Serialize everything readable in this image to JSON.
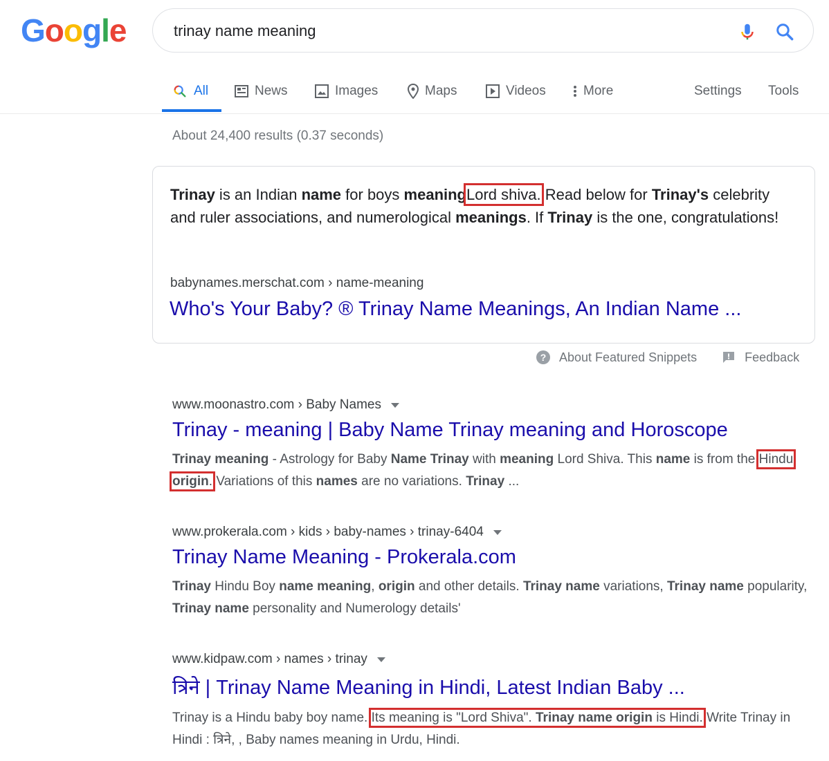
{
  "logo": {
    "letters": [
      "G",
      "o",
      "o",
      "g",
      "l",
      "e"
    ],
    "colors": [
      "#4285f4",
      "#ea4335",
      "#fbbc05",
      "#4285f4",
      "#34a853",
      "#ea4335"
    ]
  },
  "search": {
    "query": "trinay name meaning"
  },
  "tabs": {
    "all": "All",
    "news": "News",
    "images": "Images",
    "maps": "Maps",
    "videos": "Videos",
    "more": "More",
    "settings": "Settings",
    "tools": "Tools"
  },
  "stats": "About 24,400 results (0.37 seconds)",
  "snippet": {
    "t1": "Trinay",
    "t2": " is an Indian ",
    "t3": "name",
    "t4": " for boys ",
    "t5": "meaning",
    "t6": "Lord shiva.",
    "t7": " Read below for ",
    "t8": "Trinay's",
    "t9": " celebrity and ruler associations, and numerological ",
    "t10": "meanings",
    "t11": ". If ",
    "t12": "Trinay",
    "t13": " is the one, congratulations!",
    "cite": "babynames.merschat.com › name-meaning",
    "title": "Who's Your Baby? ® Trinay Name Meanings, An Indian Name ..."
  },
  "about_snippets": "About Featured Snippets",
  "feedback": "Feedback",
  "results": [
    {
      "cite": "www.moonastro.com › Baby Names",
      "title": "Trinay - meaning | Baby Name Trinay meaning and Horoscope",
      "d": [
        "Trinay meaning",
        " - Astrology for Baby ",
        "Name Trinay",
        " with ",
        "meaning",
        " Lord Shiva. This ",
        "name",
        " is from the ",
        "Hindu ",
        "origin",
        ".",
        " Variations of this ",
        "names",
        " are no variations. ",
        "Trinay",
        " ..."
      ]
    },
    {
      "cite": "www.prokerala.com › kids › baby-names › trinay-6404",
      "title": "Trinay Name Meaning - Prokerala.com",
      "d": [
        "Trinay",
        " Hindu Boy ",
        "name meaning",
        ", ",
        "origin",
        " and other details. ",
        "Trinay name",
        " variations, ",
        "Trinay name",
        " popularity, ",
        "Trinay name",
        " personality and Numerology details'"
      ]
    },
    {
      "cite": "www.kidpaw.com › names › trinay",
      "title": "त्रिने | Trinay Name Meaning in Hindi, Latest Indian Baby ...",
      "d": [
        "Trinay is a Hindu baby boy name. ",
        "Its meaning is \"Lord Shiva\". ",
        "Trinay name origin",
        " is Hindi.",
        " Write Trinay in Hindi : त्रिने, , Baby names meaning in Urdu, Hindi."
      ]
    }
  ]
}
